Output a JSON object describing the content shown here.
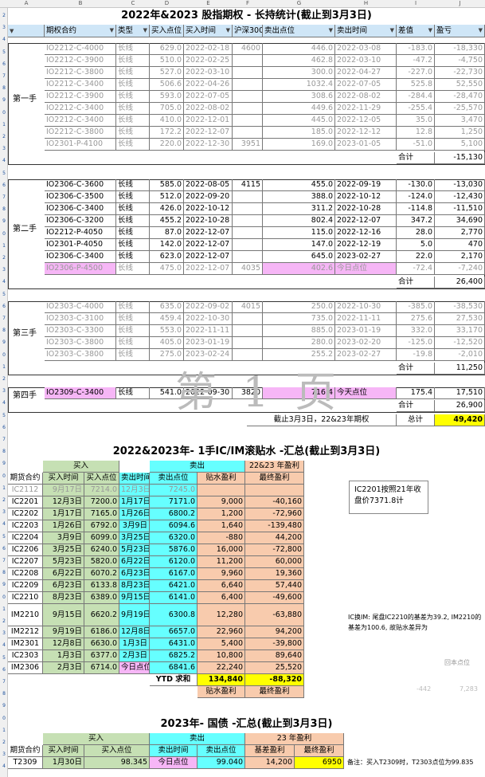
{
  "col_letters": [
    "A",
    "B",
    "C",
    "D",
    "E",
    "F",
    "G",
    "H",
    "I",
    "J"
  ],
  "title1": "2022年&2023 股指期权 - 长持统计(截止到3月3日)",
  "headers": [
    "期权合约",
    "类型",
    "买入点位",
    "买入时间",
    "沪深300",
    "卖出点位",
    "卖出时间",
    "差值",
    "盈亏"
  ],
  "dropdown_icon": "▼",
  "filter_icon": "▼",
  "group1": {
    "label": "第一手",
    "rows": [
      [
        "IO2212-C-4000",
        "长线",
        "629.0",
        "2022-02-18",
        "4600",
        "446.0",
        "2022-03-08",
        "-183.0",
        "-18,330"
      ],
      [
        "IO2212-C-3900",
        "长线",
        "510.0",
        "2022-02-25",
        "",
        "462.8",
        "2022-03-10",
        "-47.2",
        "-4,750"
      ],
      [
        "IO2212-C-3800",
        "长线",
        "527.0",
        "2022-03-10",
        "",
        "300.0",
        "2022-04-27",
        "-227.0",
        "-22,730"
      ],
      [
        "IO2212-C-3400",
        "长线",
        "506.6",
        "2022-04-26",
        "",
        "1032.4",
        "2022-07-05",
        "525.8",
        "52,550"
      ],
      [
        "IO2212-C-3900",
        "长线",
        "593.0",
        "2022-07-05",
        "",
        "308.6",
        "2022-08-02",
        "-284.4",
        "-28,470"
      ],
      [
        "IO2212-C-3400",
        "长线",
        "705.0",
        "2022-08-02",
        "",
        "449.6",
        "2022-11-29",
        "-255.4",
        "-25,570"
      ],
      [
        "IO2212-C-3400",
        "长线",
        "410.0",
        "2022-12-01",
        "",
        "445.0",
        "2022-12-05",
        "35.0",
        "3,470"
      ],
      [
        "IO2212-C-3800",
        "长线",
        "172.2",
        "2022-12-07",
        "",
        "185.0",
        "2022-12-12",
        "12.8",
        "1,250"
      ],
      [
        "IO2301-P-4100",
        "长线",
        "220.0",
        "2022-12-30",
        "3951",
        "169.0",
        "2023-01-05",
        "-51.0",
        "5,100"
      ]
    ],
    "sum_label": "合计",
    "sum": "-15,130"
  },
  "group2": {
    "label": "第二手",
    "rows": [
      [
        "IO2306-C-3600",
        "长线",
        "585.0",
        "2022-08-05",
        "4115",
        "455.0",
        "2022-09-19",
        "-130.0",
        "-13,030"
      ],
      [
        "IO2306-C-3500",
        "长线",
        "512.0",
        "2022-09-20",
        "",
        "388.0",
        "2022-10-12",
        "-124.0",
        "-12,430"
      ],
      [
        "IO2306-C-3400",
        "长线",
        "426.0",
        "2022-10-12",
        "",
        "311.2",
        "2022-10-28",
        "-114.8",
        "-11,510"
      ],
      [
        "IO2306-C-3200",
        "长线",
        "455.2",
        "2022-10-28",
        "",
        "802.4",
        "2022-12-07",
        "347.2",
        "34,690"
      ],
      [
        "IO2212-P-4050",
        "长线",
        "87.0",
        "2022-12-07",
        "",
        "115.0",
        "2022-12-16",
        "28.0",
        "2,770"
      ],
      [
        "IO2301-P-4050",
        "长线",
        "142.0",
        "2022-12-07",
        "",
        "147.0",
        "2022-12-19",
        "5.0",
        "470"
      ],
      [
        "IO2306-C-3400",
        "长线",
        "623.0",
        "2022-12-07",
        "",
        "645.0",
        "2023-02-27",
        "22.0",
        "2,170"
      ],
      [
        "IO2306-P-4500",
        "长线",
        "475.0",
        "2022-12-07",
        "4035",
        "402.6",
        "今日点位",
        "-72.4",
        "-7,240"
      ]
    ],
    "sum_label": "合计",
    "sum": "26,400"
  },
  "group3": {
    "label": "第三手",
    "rows": [
      [
        "IO2303-C-4000",
        "长线",
        "635.0",
        "2022-09-02",
        "4015",
        "250.0",
        "2022-10-30",
        "-385.0",
        "-38,530"
      ],
      [
        "IO2303-C-3100",
        "长线",
        "459.4",
        "2022-10-30",
        "",
        "735.0",
        "2022-11-11",
        "275.6",
        "27,530"
      ],
      [
        "IO2303-C-3300",
        "长线",
        "553.0",
        "2022-11-11",
        "",
        "885.0",
        "2023-01-19",
        "332.0",
        "33,170"
      ],
      [
        "IO2303-C-3800",
        "长线",
        "405.0",
        "2023-01-19",
        "",
        "280.0",
        "2023-02-20",
        "-125.0",
        "-12,520"
      ],
      [
        "IO2303-C-3800",
        "长线",
        "275.0",
        "2023-02-24",
        "",
        "255.2",
        "2023-02-27",
        "-19.8",
        "-2,010"
      ]
    ],
    "sum_label": "合计",
    "sum": "11,250"
  },
  "group4": {
    "label": "第四手",
    "row": [
      "IO2309-C-3400",
      "长线",
      "541.0",
      "2022-09-30",
      "3820",
      "716.4",
      "今天点位",
      "175.4",
      "17,510"
    ],
    "sum_label": "合计",
    "sum": "26,900"
  },
  "watermark": "第 1 页",
  "total_label": "截止3月3日，22&23年期权",
  "total_word": "总计",
  "total": "49,420",
  "title2": "2022&2023年- 1手IC/IM滚贴水 -汇总(截止到3月3日)",
  "t2_hdr1": {
    "buy": "买入",
    "sell": "卖出",
    "profit": "22&23 年盈利"
  },
  "t2_hdr2": [
    "期货合约",
    "买入时间",
    "买入点位",
    "卖出时间",
    "卖出点位",
    "贴水盈利",
    "最终盈利"
  ],
  "t2_rows": [
    [
      "IC2112",
      "9月17日",
      "7214.0",
      "12月3日",
      "7245.0",
      "",
      ""
    ],
    [
      "IC2201",
      "12月3日",
      "7200.0",
      "1月17日",
      "7171.0",
      "9,000",
      "-40,160"
    ],
    [
      "IC2202",
      "1月17日",
      "7165.0",
      "1月26日",
      "6800.2",
      "1,200",
      "-72,960"
    ],
    [
      "IC2203",
      "1月26日",
      "6792.0",
      "3月9日",
      "6094.6",
      "1,640",
      "-139,480"
    ],
    [
      "IC2204",
      "3月9日",
      "6099.0",
      "3月25日",
      "6320.0",
      "-880",
      "44,200"
    ],
    [
      "IC2206",
      "3月25日",
      "6240.0",
      "5月23日",
      "5876.0",
      "16,000",
      "-72,800"
    ],
    [
      "IC2207",
      "5月23日",
      "5820.0",
      "6月22日",
      "6120.0",
      "11,200",
      "60,000"
    ],
    [
      "IC2208",
      "6月22日",
      "6070.2",
      "6月23日",
      "6167.0",
      "9,960",
      "19,360"
    ],
    [
      "IC2209",
      "6月23日",
      "6133.8",
      "8月23日",
      "6421.0",
      "6,640",
      "57,440"
    ],
    [
      "IC2210",
      "8月23日",
      "6389.0",
      "9月15日",
      "6141.0",
      "6,400",
      "-49,600"
    ],
    [
      "IM2210",
      "9月15日",
      "6620.2",
      "9月19日",
      "6300.8",
      "12,280",
      "-63,880"
    ],
    [
      "IM2212",
      "9月19日",
      "6186.0",
      "12月8日",
      "6657.0",
      "22,960",
      "94,200"
    ],
    [
      "IM2301",
      "12月8日",
      "6630.0",
      "1月3日",
      "6431.0",
      "5,400",
      "-39,800"
    ],
    [
      "IC2303",
      "1月3日",
      "6377.0",
      "2月3日",
      "6825.2",
      "10,800",
      "89,640"
    ],
    [
      "IM2306",
      "2月3日",
      "6714.0",
      "今日点位",
      "6841.6",
      "22,240",
      "25,520"
    ]
  ],
  "ytd_label": "YTD 求和",
  "ytd_discount": "134,840",
  "ytd_final": "-88,320",
  "ytd_sub": [
    "贴水盈利",
    "最终盈利"
  ],
  "note1": "IC2201按照21年收盘价7371.8计",
  "note2": "IC换IM: 尾盘IC2210的基差为39.2, IM2210的基差为100.6, 故贴水差异为",
  "note3": "回本点位",
  "note4a": "-442",
  "note4b": "7,283",
  "title3": "2023年- 国债 -汇总(截止到3月3日)",
  "t3_hdr1": {
    "buy": "买入",
    "sell": "卖出",
    "profit": "23 年盈利"
  },
  "t3_hdr2": [
    "期货合约",
    "买入时间",
    "买入点位",
    "卖出时间",
    "卖出点位",
    "基差盈利",
    "最终盈利"
  ],
  "t3_row": [
    "T2309",
    "1月30日",
    "98.345",
    "今日点位",
    "99.040",
    "14,200",
    "6950"
  ],
  "note5": "备注：买入T2309时，T2303点位为99.835"
}
